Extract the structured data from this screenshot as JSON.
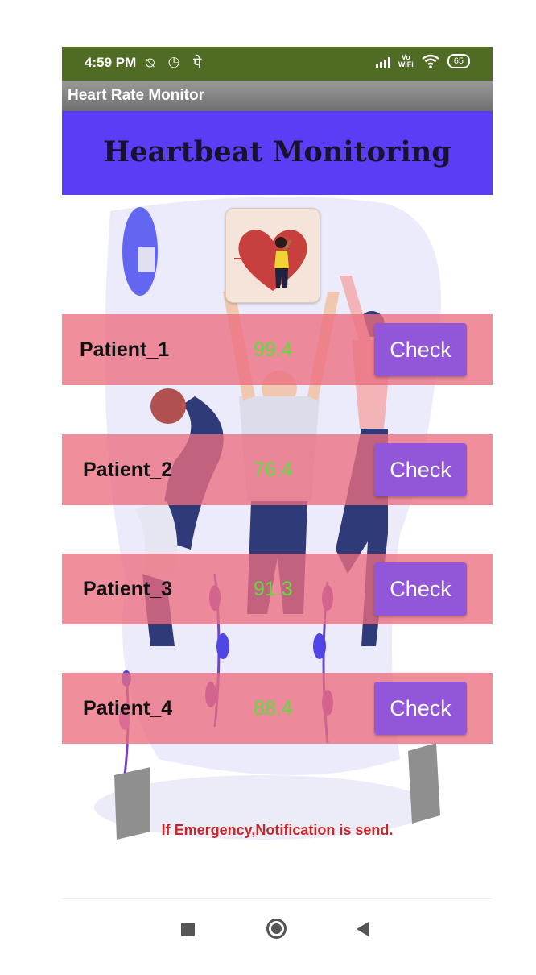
{
  "status_bar": {
    "time": "4:59 PM",
    "left_icons": [
      "notifications-off-icon",
      "alarm-icon",
      "devanagari-app-icon"
    ],
    "left_glyphs": "⍉ ◷ पे",
    "vowifi_top": "Vo",
    "vowifi_bottom": "WiFi",
    "battery": "65",
    "background_color": "#4f6b24"
  },
  "action_bar": {
    "title": "Heart Rate Monitor"
  },
  "header": {
    "title": "Heartbeat Monitoring",
    "background_color": "#5b3df5"
  },
  "heart_logo": {
    "icon": "heart-woman-pulse-icon"
  },
  "patients": [
    {
      "name": "Patient_1",
      "value": "99.4",
      "button": "Check"
    },
    {
      "name": "Patient_2",
      "value": "76.4",
      "button": "Check"
    },
    {
      "name": "Patient_3",
      "value": "91.3",
      "button": "Check"
    },
    {
      "name": "Patient_4",
      "value": "88.4",
      "button": "Check"
    }
  ],
  "emergency_text": "If Emergency,Notification is send.",
  "colors": {
    "row": "#ec6e80",
    "button": "#9257d8",
    "value": "#5fdc3a",
    "emergency": "#c62828"
  },
  "nav_bar": {
    "icons": [
      "recent-apps-icon",
      "home-icon",
      "back-icon"
    ]
  }
}
